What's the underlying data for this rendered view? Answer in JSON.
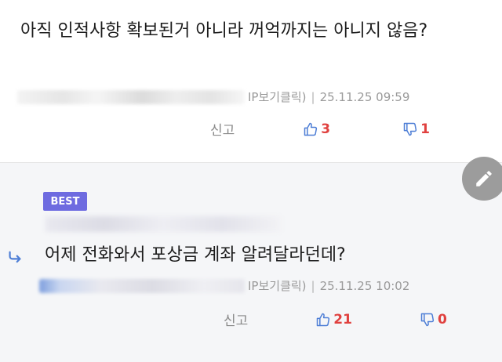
{
  "comment": {
    "text": "아직 인적사항 확보된거 아니라 꺼억까지는 아니지 않음?",
    "ip_label": "IP보기클릭)",
    "separator": "|",
    "timestamp": "25.11.25 09:59",
    "report_label": "신고",
    "upvotes": "3",
    "downvotes": "1"
  },
  "reply": {
    "badge": "BEST",
    "text": "어제 전화와서 포상금 계좌 알려달라던데?",
    "ip_label": "IP보기클릭)",
    "separator": "|",
    "timestamp": "25.11.25 10:02",
    "report_label": "신고",
    "upvotes": "21",
    "downvotes": "0"
  },
  "colors": {
    "badge": "#6e6be0",
    "vote": "#e0413f",
    "icon_blue": "#4f7fd6",
    "fab": "#9c9c9c",
    "reply_bg": "#f5f6f8"
  },
  "icons": {
    "upvote": "thumbs-up-icon",
    "downvote": "thumbs-down-icon",
    "reply": "reply-arrow-icon",
    "edit": "pencil-icon"
  }
}
